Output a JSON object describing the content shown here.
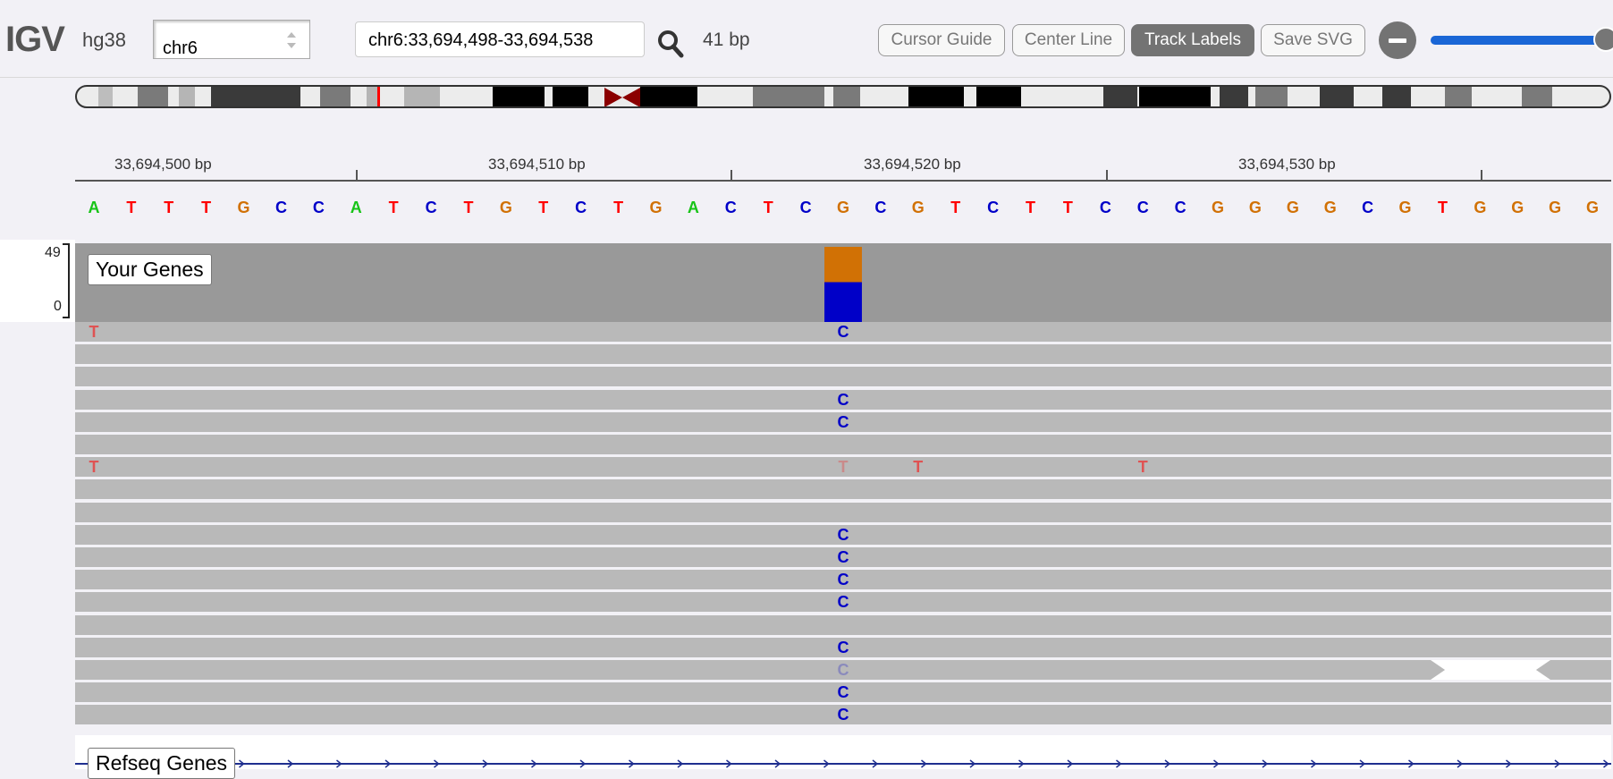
{
  "navbar": {
    "logo": "IGV",
    "genome": "hg38",
    "chromosome": "chr6",
    "locus": "chr6:33,694,498-33,694,538",
    "bp_count": "41 bp",
    "buttons": {
      "cursor_guide": "Cursor Guide",
      "center_line": "Center Line",
      "track_labels": "Track Labels",
      "save_svg": "Save SVG"
    },
    "zoom_level": 0.97
  },
  "ruler": {
    "labels": [
      "33,694,500 bp",
      "33,694,510 bp",
      "33,694,520 bp",
      "33,694,530 bp"
    ]
  },
  "sequence": {
    "bases": [
      "A",
      "T",
      "T",
      "T",
      "G",
      "C",
      "C",
      "A",
      "T",
      "C",
      "T",
      "G",
      "T",
      "C",
      "T",
      "G",
      "A",
      "C",
      "T",
      "C",
      "G",
      "C",
      "G",
      "T",
      "C",
      "T",
      "T",
      "C",
      "C",
      "C",
      "G",
      "G",
      "G",
      "G",
      "C",
      "G",
      "T",
      "G",
      "G",
      "G",
      "G"
    ]
  },
  "colors": {
    "A": "#17c417",
    "C": "#0000c8",
    "G": "#d17105",
    "T": "#ff0000",
    "coverage": "#999999",
    "read": "#b9b9b9"
  },
  "coverage": {
    "track_name": "Your Genes",
    "scale_max": "49",
    "scale_min": "0",
    "variant_position_index": 20,
    "variant_fractions": {
      "G": 0.47,
      "C": 0.53
    }
  },
  "reads": {
    "rows": [
      {
        "mismatches": [
          {
            "pos": 0,
            "base": "T",
            "faint": true
          },
          {
            "pos": 20,
            "base": "C"
          }
        ]
      },
      {
        "mismatches": []
      },
      {
        "mismatches": []
      },
      {
        "mismatches": [
          {
            "pos": 20,
            "base": "C"
          }
        ]
      },
      {
        "mismatches": [
          {
            "pos": 20,
            "base": "C"
          }
        ]
      },
      {
        "mismatches": []
      },
      {
        "mismatches": [
          {
            "pos": 0,
            "base": "T",
            "faint": true
          },
          {
            "pos": 20,
            "base": "T",
            "faint": true,
            "veryfaint": true
          },
          {
            "pos": 22,
            "base": "T",
            "faint": true
          },
          {
            "pos": 28,
            "base": "T",
            "faint": true
          }
        ]
      },
      {
        "mismatches": []
      },
      {
        "mismatches": []
      },
      {
        "mismatches": [
          {
            "pos": 20,
            "base": "C"
          }
        ]
      },
      {
        "mismatches": [
          {
            "pos": 20,
            "base": "C"
          }
        ]
      },
      {
        "mismatches": [
          {
            "pos": 20,
            "base": "C"
          }
        ]
      },
      {
        "mismatches": [
          {
            "pos": 20,
            "base": "C"
          }
        ]
      },
      {
        "mismatches": []
      },
      {
        "mismatches": [
          {
            "pos": 20,
            "base": "C"
          }
        ]
      },
      {
        "mismatches": [
          {
            "pos": 20,
            "base": "C",
            "veryfaint": true
          }
        ],
        "gap": true
      },
      {
        "mismatches": [
          {
            "pos": 20,
            "base": "C"
          }
        ]
      },
      {
        "mismatches": [
          {
            "pos": 20,
            "base": "C"
          }
        ]
      }
    ]
  },
  "refseq": {
    "track_name": "Refseq Genes"
  }
}
